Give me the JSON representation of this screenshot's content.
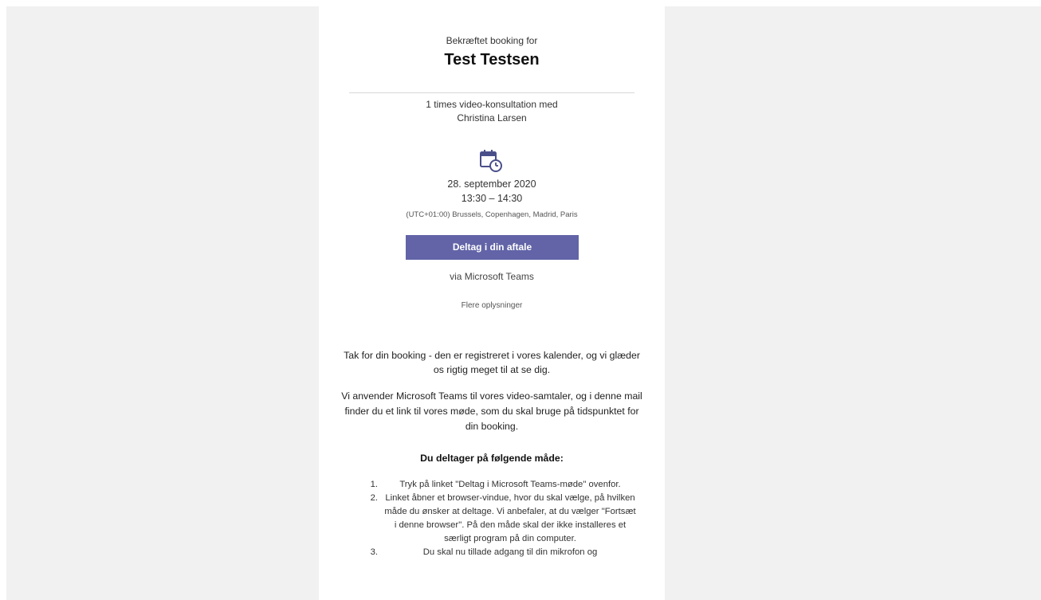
{
  "booking": {
    "confirmed_label": "Bekræftet booking for",
    "customer_name": "Test Testsen",
    "service_line1": "1 times video-konsultation med",
    "service_line2": "Christina Larsen",
    "icon": "calendar-clock-icon",
    "date": "28. september 2020",
    "time": "13:30 – 14:30",
    "timezone": "(UTC+01:00) Brussels, Copenhagen, Madrid, Paris",
    "join_button_label": "Deltag i din aftale",
    "via_label": "via Microsoft Teams",
    "more_info_label": "Flere oplysninger",
    "button_color": "#6264a7"
  },
  "body": {
    "paragraph1": "Tak for din booking - den er registreret i vores kalender, og vi glæder os rigtig meget til at se dig.",
    "paragraph2": "Vi anvender Microsoft Teams til vores video-samtaler, og i denne mail finder du et link til vores møde, som du skal bruge på tidspunktet for din booking.",
    "steps_heading": "Du deltager på følgende måde:",
    "steps": [
      {
        "num": "1.",
        "text": "Tryk på linket \"Deltag i Microsoft Teams-møde\" ovenfor."
      },
      {
        "num": "2.",
        "text": "Linket åbner et browser-vindue, hvor du skal vælge, på hvilken måde du ønsker at deltage. Vi anbefaler, at du vælger \"Fortsæt i denne browser\". På den måde skal der ikke installeres et særligt program på din computer."
      },
      {
        "num": "3.",
        "text": "Du skal nu tillade adgang til din mikrofon og"
      }
    ]
  }
}
